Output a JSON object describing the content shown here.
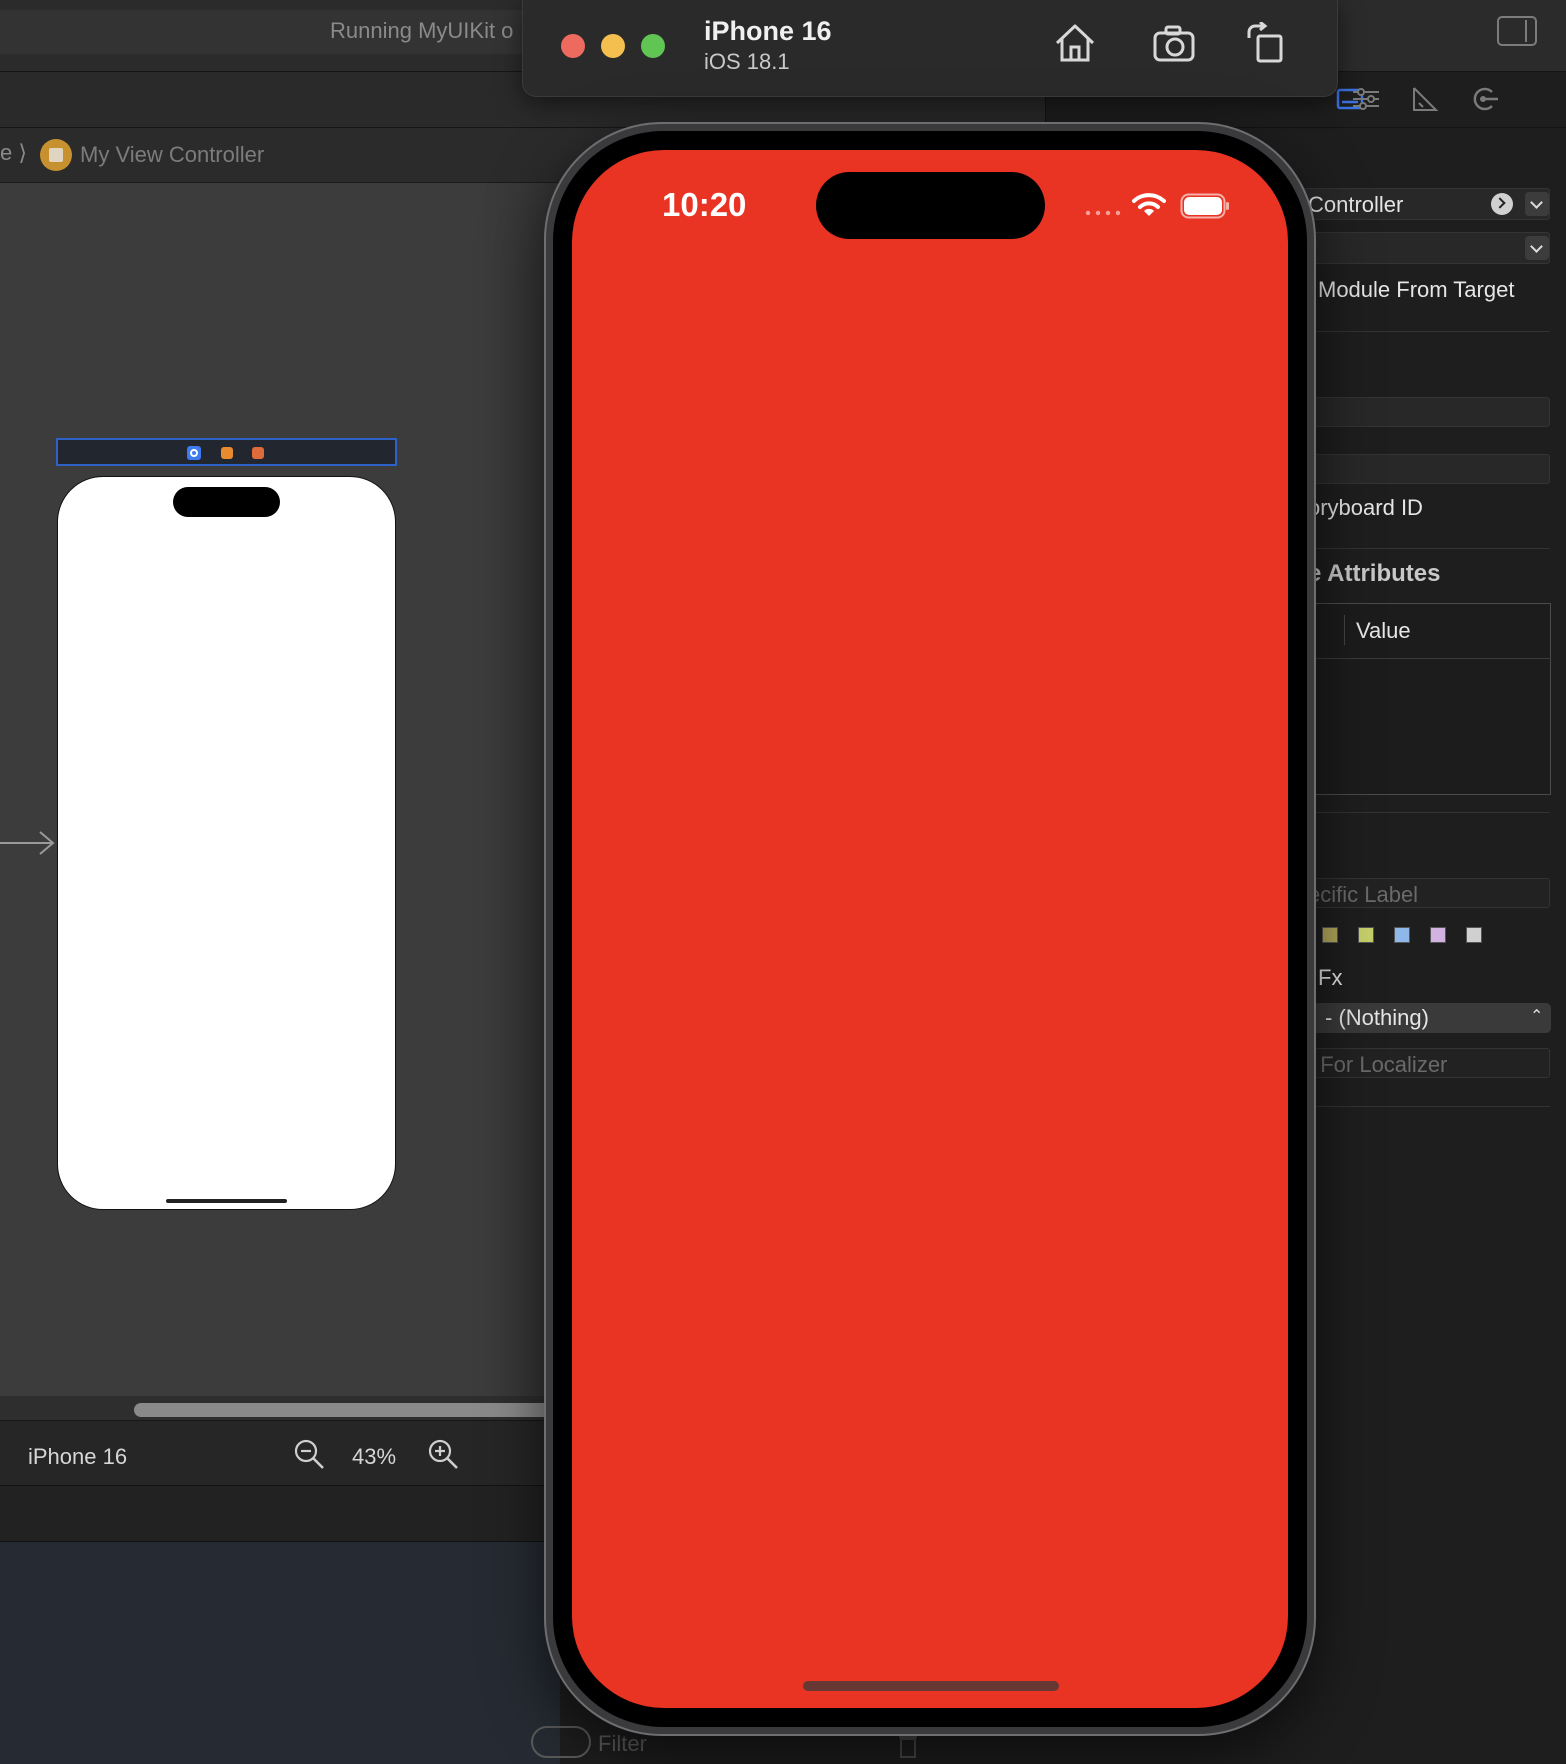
{
  "xcode": {
    "status": "Running MyUIKit o",
    "jumpbar": {
      "chevron": "e ⟩",
      "scene": "My View Controller"
    },
    "canvas_bottom": {
      "device": "iPhone 16",
      "zoom": "43%"
    },
    "filter_placeholder": "Filter"
  },
  "inspector": {
    "class_value": "Controller",
    "module_text": "Module From Target",
    "storyboard_id_label": "oryboard ID",
    "section_attributes": "e Attributes",
    "attr_table_value_header": "Value",
    "specific_label": "ecific Label",
    "fx_label": "Fx",
    "popup_value": "- (Nothing)",
    "localizer_label": "t For Localizer",
    "swatch_colors": [
      "#b6aa5c",
      "#c6d06a",
      "#8fb8ea",
      "#d2b2e0",
      "#d0d0d0"
    ]
  },
  "simulator": {
    "device": "iPhone 16",
    "os": "iOS 18.1",
    "time": "10:20",
    "screen_color": "#e93323"
  }
}
